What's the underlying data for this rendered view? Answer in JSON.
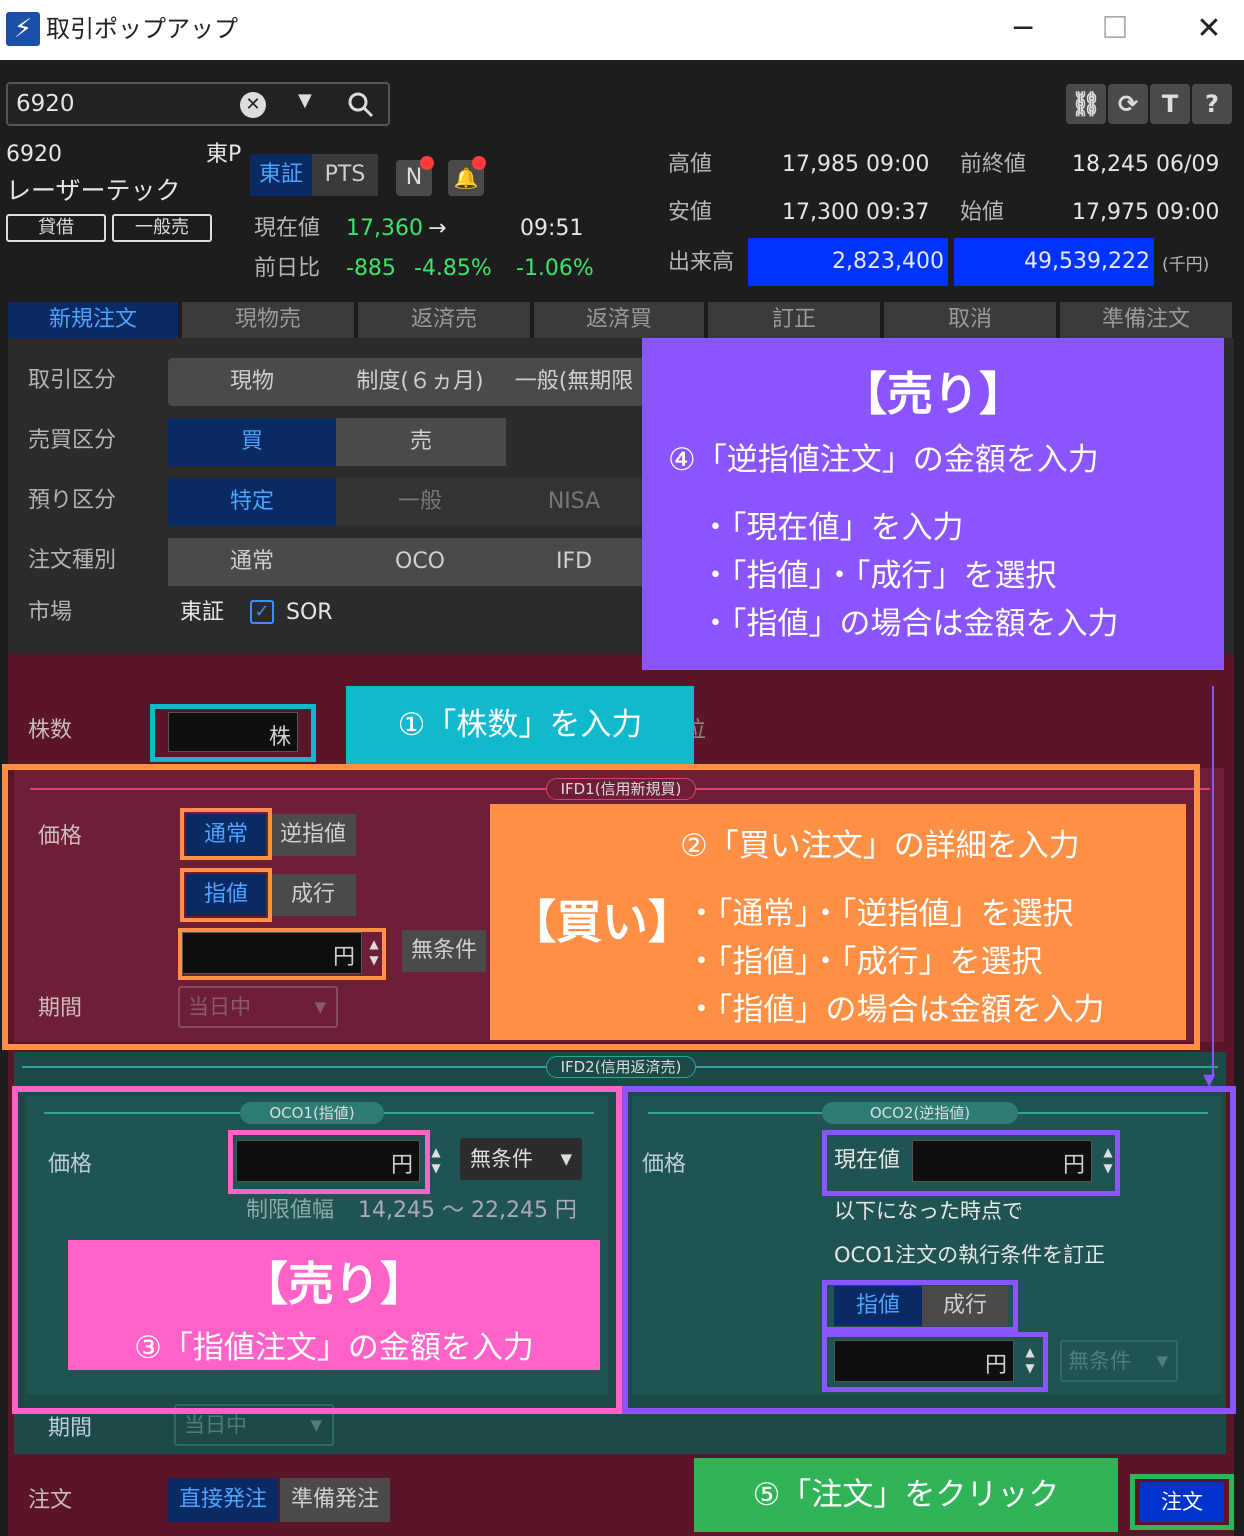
{
  "window": {
    "title": "取引ポップアップ",
    "app_icon": "lightning-icon",
    "minimize": "─",
    "maximize": "☐",
    "close": "✕"
  },
  "search": {
    "code": "6920"
  },
  "stock": {
    "code": "6920",
    "name": "レーザーテック",
    "market": "東P",
    "badges": [
      "貸借",
      "一般売"
    ],
    "exchange_tabs": [
      "東証",
      "PTS"
    ],
    "news_badge": "N",
    "current_label": "現在値",
    "current": "17,360",
    "arrow": "→",
    "time": "09:51",
    "change_label": "前日比",
    "change": "-885",
    "change_pct": "-4.85%",
    "vwap_pct": "-1.06%"
  },
  "quotes": {
    "high_label": "高値",
    "high": "17,985 09:00",
    "prev_close_label": "前終値",
    "prev_close": "18,245 06/09",
    "low_label": "安値",
    "low": "17,300 09:37",
    "open_label": "始値",
    "open": "17,975 09:00",
    "volume_label": "出来高",
    "volume": "2,823,400",
    "value": "49,539,222",
    "value_unit": "(千円)"
  },
  "tabs": [
    "新規注文",
    "現物売",
    "返済売",
    "返済買",
    "訂正",
    "取消",
    "準備注文"
  ],
  "form": {
    "trade_type_label": "取引区分",
    "trade_types": [
      "現物",
      "制度(６ヵ月)",
      "一般(無期限"
    ],
    "side_label": "売買区分",
    "sides": [
      "買",
      "売"
    ],
    "account_label": "預り区分",
    "accounts": [
      "特定",
      "一般",
      "NISA"
    ],
    "order_type_label": "注文種別",
    "order_types": [
      "通常",
      "OCO",
      "IFD"
    ],
    "market_label": "市場",
    "market": "東証",
    "sor": "SOR",
    "qty_label": "株数",
    "qty_unit": "株",
    "qty_tail": "位"
  },
  "ifd1": {
    "header": "IFD1(信用新規買)",
    "price_label": "価格",
    "normal": "通常",
    "stop": "逆指値",
    "limit": "指値",
    "market": "成行",
    "yen": "円",
    "cond": "無条件",
    "period_label": "期間",
    "period": "当日中"
  },
  "ifd2": {
    "header": "IFD2(信用返済売)",
    "oco1": {
      "header": "OCO1(指値)",
      "price_label": "価格",
      "yen": "円",
      "cond": "無条件",
      "range_label": "制限値幅",
      "range": "14,245 ～ 22,245 円"
    },
    "oco2": {
      "header": "OCO2(逆指値)",
      "price_label": "価格",
      "current": "現在値",
      "yen": "円",
      "line1": "以下になった時点で",
      "line2": "OCO1注文の執行条件を訂正",
      "limit": "指値",
      "market": "成行",
      "cond": "無条件"
    },
    "period_label": "期間",
    "period": "当日中"
  },
  "footer": {
    "order_label": "注文",
    "direct": "直接発注",
    "prep": "準備発注",
    "submit": "注文"
  },
  "annotations": {
    "a1": "①「株数」を入力",
    "a2_title": "【買い】",
    "a2": "②「買い注文」の詳細を入力",
    "a2_b1": "・「通常」・「逆指値」を選択",
    "a2_b2": "・「指値」・「成行」を選択",
    "a2_b3": "・「指値」の場合は金額を入力",
    "a3_title": "【売り】",
    "a3": "③「指値注文」の金額を入力",
    "a4_title": "【売り】",
    "a4": "④「逆指値注文」の金額を入力",
    "a4_b1": "・「現在値」を入力",
    "a4_b2": "・「指値」・「成行」を選択",
    "a4_b3": "・「指値」の場合は金額を入力",
    "a5": "⑤「注文」をクリック"
  },
  "colors": {
    "orange": "#ff8f45",
    "pink": "#ff63c7",
    "purple": "#8a55ff",
    "teal": "#10b9cb",
    "green": "#30b457",
    "blue_on": "#0a2a63"
  }
}
